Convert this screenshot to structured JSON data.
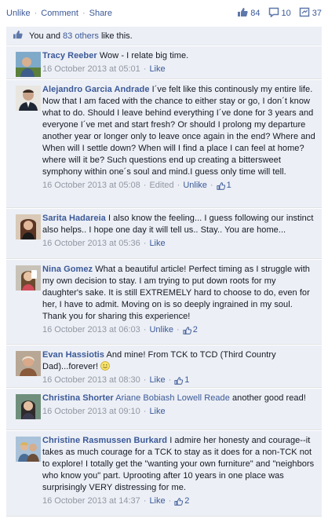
{
  "actions": {
    "unlike": "Unlike",
    "comment": "Comment",
    "share": "Share",
    "sep": "·",
    "likes_count": "84",
    "comments_count": "10",
    "shares_count": "37"
  },
  "like_summary": {
    "prefix": "You and",
    "others_link": "83 others",
    "suffix": "like this."
  },
  "meta_labels": {
    "like": "Like",
    "unlike": "Unlike",
    "edited": "Edited",
    "dot": "·"
  },
  "comments": [
    {
      "author": "Tracy Reeber",
      "text": "Wow - I relate big time.",
      "timestamp": "16 October 2013 at 05:01",
      "action": "Like"
    },
    {
      "author": "Alejandro Garcia Andrade",
      "text": "I´ve felt like this continously my entire life. Now that I am faced with the chance to either stay or go, I don´t know what to do. Should I leave behind everything I´ve done for 3 years and everyone I´ve met and start fresh? Or should I prolong my departure another year or longer only to leave once again in the end? Where and When will I settle down? When will I find a place I can feel at home? where will it be? Such questions end up creating a bittersweet symphony within one´s soul and mind.I guess only time will tell.",
      "timestamp": "16 October 2013 at 05:08",
      "edited": "Edited",
      "action": "Unlike",
      "like_count": "1"
    },
    {
      "author": "Sarita Hadareia",
      "text": "I also know the feeling... I guess following our instinct also helps.. I hope one day it will tell us.. Stay.. You are home...",
      "timestamp": "16 October 2013 at 05:36",
      "action": "Like"
    },
    {
      "author": "Nina Gomez",
      "text": "What a beautiful article! Perfect timing as I struggle with my own decision to stay. I am trying to put down roots for my daughter's sake. It is still EXTREMELY hard to choose to do, even for her, I have to admit. Moving on is so deeply ingrained in my soul. Thank you for sharing this experience!",
      "timestamp": "16 October 2013 at 06:03",
      "action": "Unlike",
      "like_count": "2"
    },
    {
      "author": "Evan Hassiotis",
      "text": "And mine! From TCK to TCD (Third Country Dad)...forever!",
      "timestamp": "16 October 2013 at 08:30",
      "action": "Like",
      "like_count": "1"
    },
    {
      "author": "Christina Shorter",
      "tagged": "Ariane Bobiash Lowell Reade",
      "text": "another good read!",
      "timestamp": "16 October 2013 at 09:10",
      "action": "Like"
    },
    {
      "author": "Christine Rasmussen Burkard",
      "text": "I admire her honesty and courage--it takes as much courage for a TCK to stay as it does for a non-TCK not to explore! I totally get the \"wanting your own furniture\" and \"neighbors who know you\" part. Uprooting after 10 years in one place was surprisingly VERY distressing for me.",
      "timestamp": "16 October 2013 at 14:37",
      "action": "Like",
      "like_count": "2"
    }
  ],
  "colors": {
    "link": "#3b5998",
    "comment_bg": "#eceff5",
    "meta": "#9197a3"
  },
  "icons": [
    "thumbs-up-icon",
    "comment-bubble-icon",
    "share-icon",
    "smiley-icon"
  ]
}
